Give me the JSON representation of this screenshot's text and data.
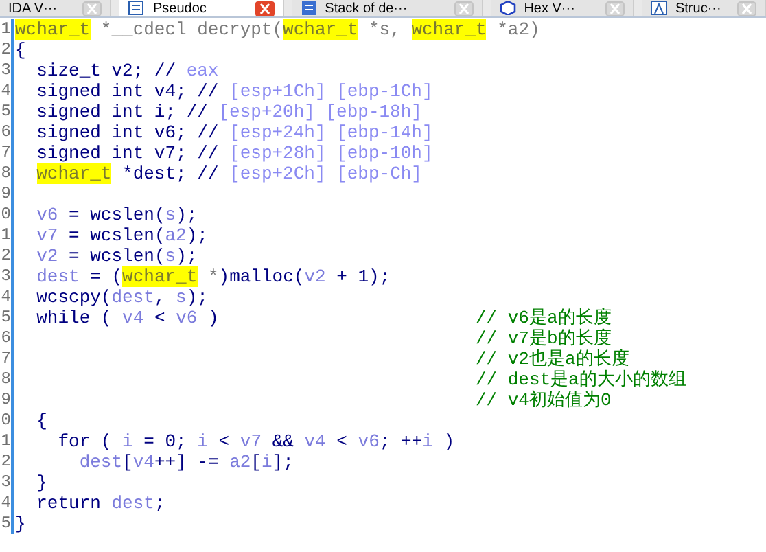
{
  "tabs": [
    {
      "label": "IDA V···",
      "selected": false
    },
    {
      "label": "Pseudoc",
      "selected": true
    },
    {
      "label": "Stack of de···",
      "selected": false
    },
    {
      "label": "Hex V···",
      "selected": false
    },
    {
      "label": "Struc···",
      "selected": false
    }
  ],
  "code_lines": [
    {
      "num": "1",
      "tokens": [
        {
          "kind": "type",
          "text": "wchar_t"
        },
        {
          "kind": "grey",
          "text": " *__cdecl decrypt("
        },
        {
          "kind": "type",
          "text": "wchar_t"
        },
        {
          "kind": "grey",
          "text": " *s, "
        },
        {
          "kind": "type",
          "text": "wchar_t"
        },
        {
          "kind": "grey",
          "text": " *a2)"
        }
      ]
    },
    {
      "num": "2",
      "tokens": [
        {
          "kind": "plain",
          "text": "{"
        }
      ]
    },
    {
      "num": "3",
      "tokens": [
        {
          "kind": "plain",
          "text": "  size_t v2; // "
        },
        {
          "kind": "cmt",
          "text": "eax"
        }
      ]
    },
    {
      "num": "4",
      "tokens": [
        {
          "kind": "plain",
          "text": "  signed int v4; // "
        },
        {
          "kind": "cmt",
          "text": "[esp+1Ch] [ebp-1Ch]"
        }
      ]
    },
    {
      "num": "5",
      "tokens": [
        {
          "kind": "plain",
          "text": "  signed int i; // "
        },
        {
          "kind": "cmt",
          "text": "[esp+20h] [ebp-18h]"
        }
      ]
    },
    {
      "num": "6",
      "tokens": [
        {
          "kind": "plain",
          "text": "  signed int v6; // "
        },
        {
          "kind": "cmt",
          "text": "[esp+24h] [ebp-14h]"
        }
      ]
    },
    {
      "num": "7",
      "tokens": [
        {
          "kind": "plain",
          "text": "  signed int v7; // "
        },
        {
          "kind": "cmt",
          "text": "[esp+28h] [ebp-10h]"
        }
      ]
    },
    {
      "num": "8",
      "tokens": [
        {
          "kind": "type",
          "text": "  wchar_t"
        },
        {
          "kind": "plain",
          "text": " *dest; // "
        },
        {
          "kind": "cmt",
          "text": "[esp+2Ch] [ebp-Ch]"
        }
      ]
    },
    {
      "num": "9"
    },
    {
      "num": "0",
      "tokens": [
        {
          "kind": "var",
          "text": "  v6"
        },
        {
          "kind": "plain",
          "text": " = wcslen("
        },
        {
          "kind": "var",
          "text": "s"
        },
        {
          "kind": "plain",
          "text": ");"
        }
      ]
    },
    {
      "num": "1",
      "tokens": [
        {
          "kind": "var",
          "text": "  v7"
        },
        {
          "kind": "plain",
          "text": " = wcslen("
        },
        {
          "kind": "var",
          "text": "a2"
        },
        {
          "kind": "plain",
          "text": ");"
        }
      ]
    },
    {
      "num": "2",
      "tokens": [
        {
          "kind": "var",
          "text": "  v2"
        },
        {
          "kind": "plain",
          "text": " = wcslen("
        },
        {
          "kind": "var",
          "text": "s"
        },
        {
          "kind": "plain",
          "text": ");"
        }
      ]
    },
    {
      "num": "3",
      "tokens": [
        {
          "kind": "var",
          "text": "  dest"
        },
        {
          "kind": "plain",
          "text": " = ("
        },
        {
          "kind": "type",
          "text": "wchar_t"
        },
        {
          "kind": "grey",
          "text": " *"
        },
        {
          "kind": "plain",
          "text": ")malloc("
        },
        {
          "kind": "var",
          "text": "v2"
        },
        {
          "kind": "plain",
          "text": " + 1);"
        }
      ]
    },
    {
      "num": "4",
      "tokens": [
        {
          "kind": "plain",
          "text": "  wcscpy("
        },
        {
          "kind": "var",
          "text": "dest"
        },
        {
          "kind": "plain",
          "text": ", "
        },
        {
          "kind": "var",
          "text": "s"
        },
        {
          "kind": "plain",
          "text": ");"
        }
      ]
    },
    {
      "num": "5",
      "tokens": [
        {
          "kind": "plain",
          "text": "  while ( "
        },
        {
          "kind": "var",
          "text": "v4"
        },
        {
          "kind": "plain",
          "text": " < "
        },
        {
          "kind": "var",
          "text": "v6"
        },
        {
          "kind": "plain",
          "text": " )"
        }
      ],
      "note": "// v6是a的长度"
    },
    {
      "num": "6",
      "note": "// v7是b的长度"
    },
    {
      "num": "7",
      "note": "// v2也是a的长度"
    },
    {
      "num": "8",
      "note": "// dest是a的大小的数组"
    },
    {
      "num": "9",
      "note": "// v4初始值为0"
    },
    {
      "num": "0",
      "tokens": [
        {
          "kind": "plain",
          "text": "  {"
        }
      ]
    },
    {
      "num": "1",
      "tokens": [
        {
          "kind": "plain",
          "text": "    for ( "
        },
        {
          "kind": "var",
          "text": "i"
        },
        {
          "kind": "plain",
          "text": " = 0; "
        },
        {
          "kind": "var",
          "text": "i"
        },
        {
          "kind": "plain",
          "text": " < "
        },
        {
          "kind": "var",
          "text": "v7"
        },
        {
          "kind": "plain",
          "text": " && "
        },
        {
          "kind": "var",
          "text": "v4"
        },
        {
          "kind": "plain",
          "text": " < "
        },
        {
          "kind": "var",
          "text": "v6"
        },
        {
          "kind": "plain",
          "text": "; ++"
        },
        {
          "kind": "var",
          "text": "i"
        },
        {
          "kind": "plain",
          "text": " )"
        }
      ]
    },
    {
      "num": "2",
      "tokens": [
        {
          "kind": "var",
          "text": "      dest"
        },
        {
          "kind": "plain",
          "text": "["
        },
        {
          "kind": "var",
          "text": "v4"
        },
        {
          "kind": "plain",
          "text": "++] -= "
        },
        {
          "kind": "var",
          "text": "a2"
        },
        {
          "kind": "plain",
          "text": "["
        },
        {
          "kind": "var",
          "text": "i"
        },
        {
          "kind": "plain",
          "text": "];"
        }
      ]
    },
    {
      "num": "3",
      "tokens": [
        {
          "kind": "plain",
          "text": "  }"
        }
      ]
    },
    {
      "num": "4",
      "tokens": [
        {
          "kind": "plain",
          "text": "  return "
        },
        {
          "kind": "var",
          "text": "dest"
        },
        {
          "kind": "plain",
          "text": ";"
        }
      ]
    },
    {
      "num": "5",
      "tokens": [
        {
          "kind": "plain",
          "text": "}"
        }
      ]
    }
  ]
}
